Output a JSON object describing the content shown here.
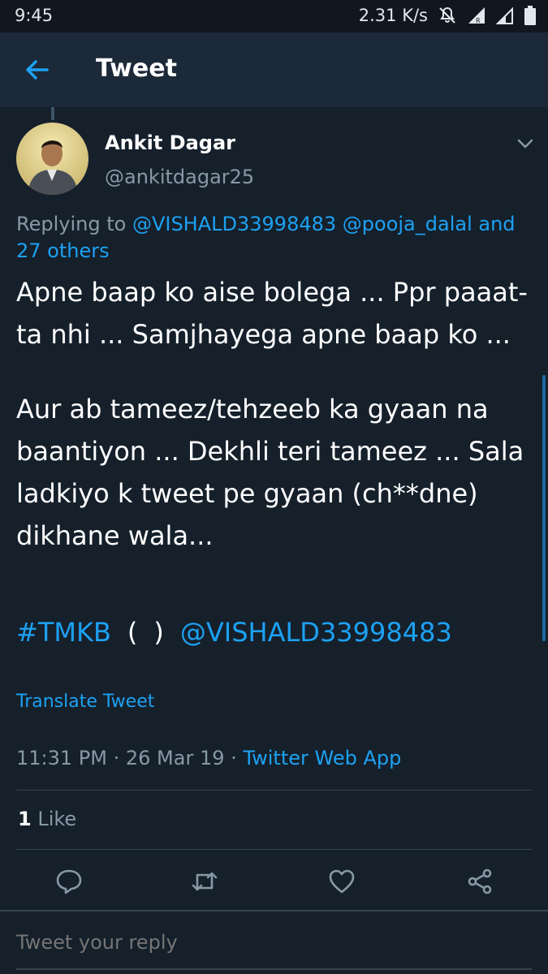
{
  "status_bar": {
    "time": "9:45",
    "net_speed": "2.31 K/s",
    "icons": [
      "mute-icon",
      "signal-roaming-icon",
      "signal-icon",
      "battery-icon"
    ]
  },
  "app_bar": {
    "title": "Tweet",
    "back_icon": "arrow-left-icon"
  },
  "tweet": {
    "author_name": "Ankit Dagar",
    "author_handle": "@ankitdagar25",
    "replying_prefix": "Replying to",
    "replying_to": "@VISHALD33998483 @pooja_dalal and 27 others",
    "paragraph_1": "Apne baap ko aise bolega ... Ppr paaat-ta nhi ... Samjhayega apne baap ko ...",
    "paragraph_2": "Aur ab tameez/tehzeeb ka gyaan na baantiyon ... Dekhli teri tameez ... Sala ladkiyo k tweet pe gyaan (ch**dne) dikhane wala...",
    "hashtag": "#TMKB",
    "paren_open": "(",
    "paren_close": ")",
    "mention": "@VISHALD33998483",
    "translate_label": "Translate Tweet",
    "time": "11:31 PM",
    "date": "26 Mar 19",
    "source": "Twitter Web App",
    "like_count": "1",
    "like_label": "Like"
  },
  "actions": [
    {
      "name": "reply-icon"
    },
    {
      "name": "retweet-icon"
    },
    {
      "name": "like-icon"
    },
    {
      "name": "share-icon"
    }
  ],
  "reply_box": {
    "placeholder": "Tweet your reply"
  },
  "colors": {
    "background": "#15202b",
    "app_bar": "#1c2938",
    "accent": "#1da1f2",
    "secondary_text": "#8899a6"
  }
}
